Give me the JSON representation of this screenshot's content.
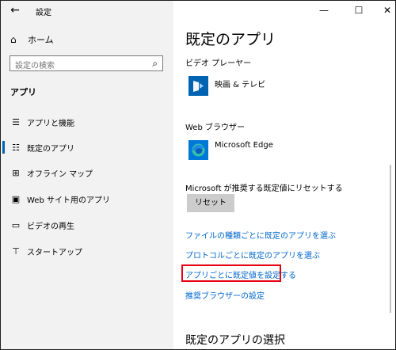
{
  "titlebar": {
    "back_icon": "arrow-left-icon",
    "title": "設定",
    "minimize_icon": "minimize-icon",
    "maximize_icon": "maximize-icon",
    "close_icon": "close-icon"
  },
  "sidebar": {
    "home_label": "ホーム",
    "home_icon": "home-icon",
    "search_placeholder": "設定の検索",
    "search_icon": "search-icon",
    "section_title": "アプリ",
    "items": [
      {
        "label": "アプリと機能",
        "icon": "list-icon",
        "selected": false
      },
      {
        "label": "既定のアプリ",
        "icon": "default-apps-icon",
        "selected": true
      },
      {
        "label": "オフライン マップ",
        "icon": "map-icon",
        "selected": false
      },
      {
        "label": "Web サイト用のアプリ",
        "icon": "web-app-icon",
        "selected": false
      },
      {
        "label": "ビデオの再生",
        "icon": "video-icon",
        "selected": false
      },
      {
        "label": "スタートアップ",
        "icon": "startup-icon",
        "selected": false
      }
    ]
  },
  "main": {
    "title": "既定のアプリ",
    "video_player": {
      "label": "ビデオ プレーヤー",
      "app_name": "映画 & テレビ",
      "app_icon": "movies-tv-icon"
    },
    "web_browser": {
      "label": "Web ブラウザー",
      "app_name": "Microsoft Edge",
      "app_icon": "edge-icon"
    },
    "reset": {
      "label": "Microsoft が推奨する既定値にリセットする",
      "button": "リセット"
    },
    "links": [
      "ファイルの種類ごとに既定のアプリを選ぶ",
      "プロトコルごとに既定のアプリを選ぶ",
      "アプリごとに既定値を設定する",
      "推奨ブラウザーの設定"
    ],
    "section2_title": "既定のアプリの選択",
    "highlight_color": "#e60012",
    "link_color": "#0066cc",
    "accent_color": "#0063b1"
  }
}
